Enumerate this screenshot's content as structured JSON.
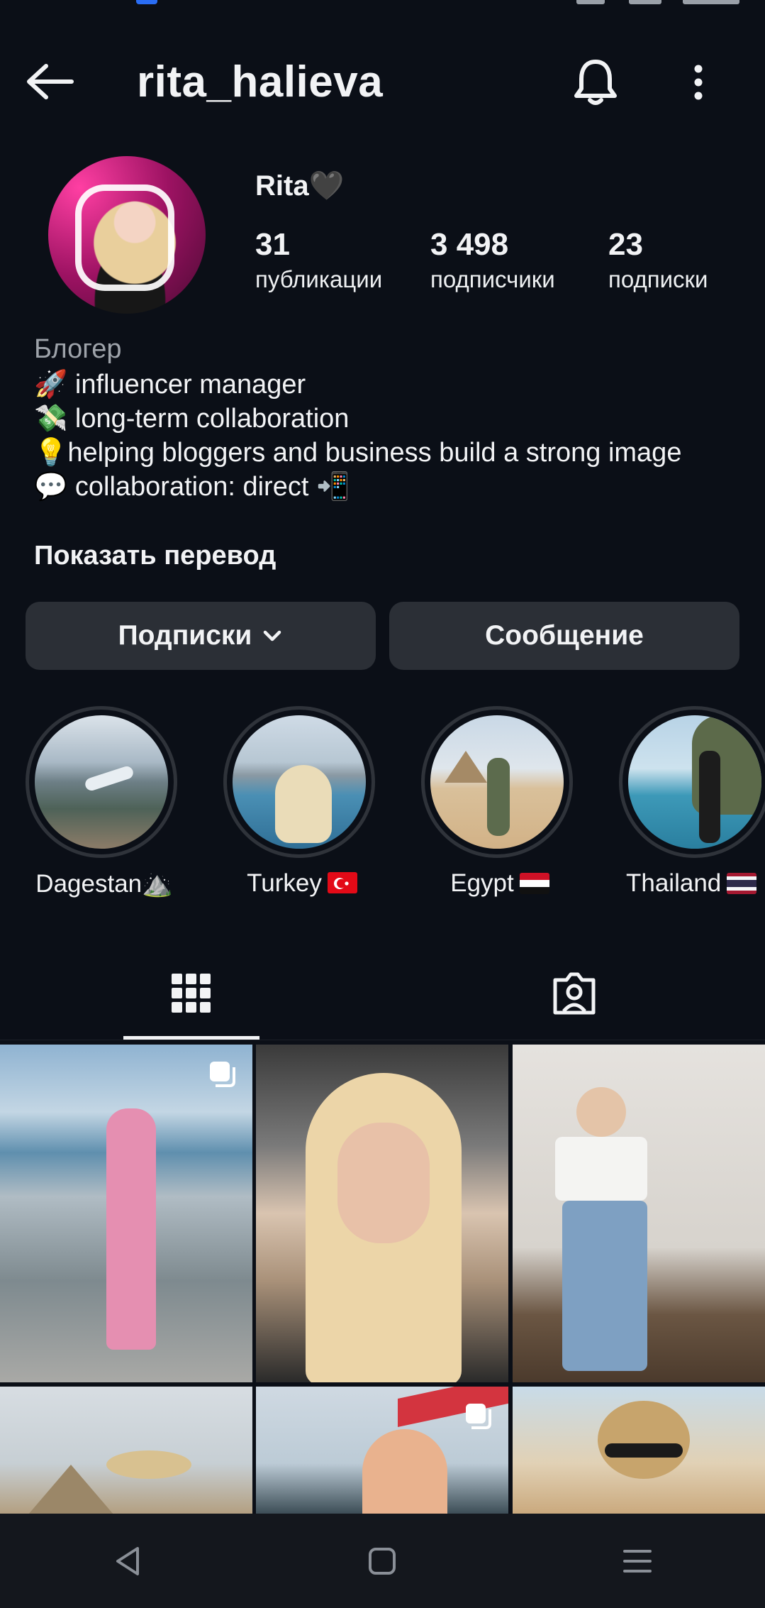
{
  "header": {
    "username": "rita_halieva",
    "back_icon": "arrow-left-icon",
    "bell_icon": "bell-icon",
    "more_icon": "more-vertical-icon"
  },
  "profile": {
    "display_name": "Rita🖤",
    "stats": [
      {
        "value": "31",
        "label": "публикации"
      },
      {
        "value": "3 498",
        "label": "подписчики"
      },
      {
        "value": "23",
        "label": "подписки"
      }
    ],
    "category": "Блогер",
    "bio_lines": [
      "🚀 influencer manager",
      "💸 long-term collaboration",
      "💡helping bloggers and business build a strong image",
      "💬 collaboration: direct 📲"
    ],
    "translate_link": "Показать перевод"
  },
  "actions": {
    "following_label": "Подписки",
    "message_label": "Сообщение"
  },
  "highlights": [
    {
      "label": "Dagestan⛰️"
    },
    {
      "label": "Turkey"
    },
    {
      "label": "Egypt"
    },
    {
      "label": "Thailand"
    }
  ],
  "tabs": {
    "grid_icon": "grid-icon",
    "tagged_icon": "tagged-person-icon",
    "active": "grid"
  },
  "colors": {
    "background": "#0b0f17",
    "button": "#2b2f36",
    "text": "#f2f3f5",
    "muted": "#9ea3aa"
  },
  "nav": {
    "back_icon": "nav-back-icon",
    "home_icon": "nav-home-icon",
    "menu_icon": "nav-menu-icon"
  }
}
